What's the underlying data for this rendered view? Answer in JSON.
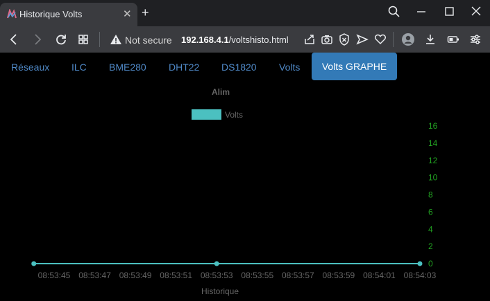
{
  "browser": {
    "tab_title": "Historique Volts",
    "new_tab_label": "+",
    "security_label": "Not secure",
    "url_host": "192.168.4.1",
    "url_path": "/voltshisto.html"
  },
  "nav": {
    "items": [
      "Réseaux",
      "ILC",
      "BME280",
      "DHT22",
      "DS1820",
      "Volts"
    ],
    "active": "Volts GRAPHE"
  },
  "chart_data": {
    "type": "line",
    "title": "Alim",
    "xlabel": "Historique",
    "x": [
      "08:53:45",
      "08:53:47",
      "08:53:49",
      "08:53:51",
      "08:53:53",
      "08:53:55",
      "08:53:57",
      "08:53:59",
      "08:54:01",
      "08:54:03"
    ],
    "series": [
      {
        "name": "Volts",
        "points": [
          [
            "08:53:44",
            0
          ],
          [
            "08:53:53",
            0
          ],
          [
            "08:54:03",
            0
          ]
        ],
        "color": "#4bc0c0"
      }
    ],
    "yticks": [
      0,
      2,
      4,
      6,
      8,
      10,
      12,
      14,
      16
    ],
    "ylim": [
      0,
      16
    ],
    "y_axis_position": "right",
    "y_tick_color": "#22a322",
    "legend_position": "top",
    "grid": false
  }
}
